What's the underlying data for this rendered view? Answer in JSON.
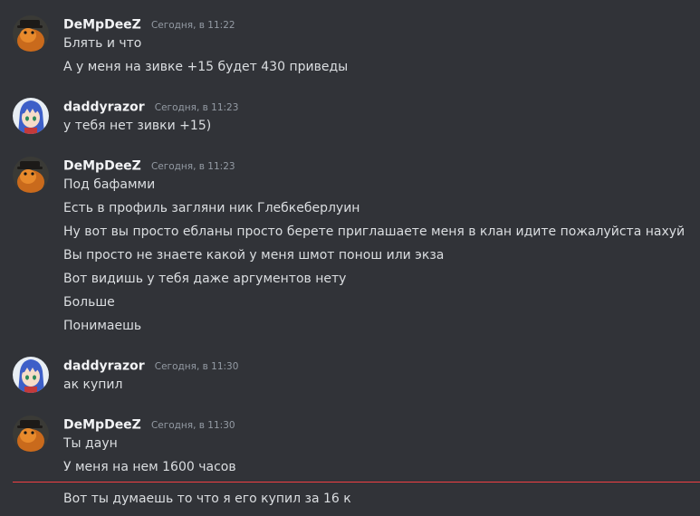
{
  "messages": [
    {
      "author": "DeMpDeeZ",
      "time": "Сегодня, в 11:22",
      "lines": [
        "Блять и что",
        "А у меня на зивке +15 будет 430 приведы"
      ]
    },
    {
      "author": "daddyrazor",
      "time": "Сегодня, в 11:23",
      "lines": [
        "у тебя нет зивки +15)"
      ]
    },
    {
      "author": "DeMpDeeZ",
      "time": "Сегодня, в 11:23",
      "lines": [
        "Под бафамми",
        "Есть в профиль загляни ник Глебкеберлуин",
        "Ну вот вы просто ебланы просто берете приглашаете меня в клан идите пожалуйста нахуй",
        "Вы просто не знаете какой у меня шмот понош или экза",
        "Вот видишь у тебя даже аргументов нету",
        "Больше",
        "Понимаешь"
      ]
    },
    {
      "author": "daddyrazor",
      "time": "Сегодня, в 11:30",
      "lines": [
        "ак купил"
      ]
    },
    {
      "author": "DeMpDeeZ",
      "time": "Сегодня, в 11:30",
      "lines": [
        "Ты даун",
        "У меня на нем 1600 часов"
      ]
    }
  ],
  "new_message": "Вот ты думаешь то что я его купил за 16 к",
  "colors": {
    "background": "#313338",
    "username": "#f2f3f5",
    "timestamp": "#949ba4",
    "text": "#dbdee1",
    "new_messages_divider": "#f23f43"
  }
}
